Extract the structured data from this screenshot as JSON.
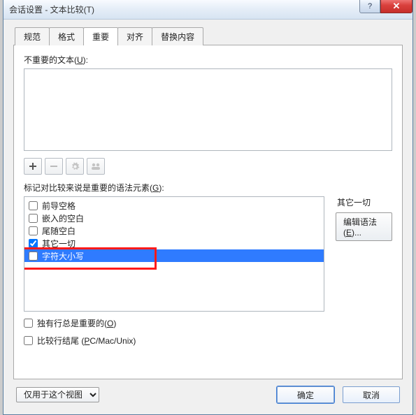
{
  "window": {
    "title": "会话设置 - 文本比较(T)"
  },
  "tabs": [
    {
      "label": "规范"
    },
    {
      "label": "格式"
    },
    {
      "label": "重要"
    },
    {
      "label": "对齐"
    },
    {
      "label": "替换内容"
    }
  ],
  "active_tab_index": 2,
  "unimportant_text": {
    "label_prefix": "不重要的文本(",
    "label_key": "U",
    "label_suffix": "):",
    "value": ""
  },
  "toolbar_icons": [
    "plus-icon",
    "minus-icon",
    "gear-icon",
    "group-icon"
  ],
  "grammar": {
    "label_prefix": "标记对比较来说是重要的语法元素(",
    "label_key": "G",
    "label_suffix": "):",
    "items": [
      {
        "label": "前导空格",
        "checked": false,
        "selected": false
      },
      {
        "label": "嵌入的空白",
        "checked": false,
        "selected": false
      },
      {
        "label": "尾随空白",
        "checked": false,
        "selected": false
      },
      {
        "label": "其它一切",
        "checked": true,
        "selected": false
      },
      {
        "label": "字符大小写",
        "checked": false,
        "selected": true
      }
    ]
  },
  "right": {
    "others_label": "其它一切",
    "edit_grammar_prefix": "编辑语法(",
    "edit_grammar_key": "E",
    "edit_grammar_suffix": ")..."
  },
  "checks": {
    "orphan_prefix": "独有行总是重要的(",
    "orphan_key": "O",
    "orphan_suffix": ")",
    "orphan_checked": false,
    "line_endings_prefix": "比较行结尾 (",
    "line_endings_key": "P",
    "line_endings_suffix": "C/Mac/Unix)",
    "line_endings_checked": false
  },
  "footer": {
    "scope_selected": "仅用于这个视图",
    "ok": "确定",
    "cancel": "取消"
  }
}
